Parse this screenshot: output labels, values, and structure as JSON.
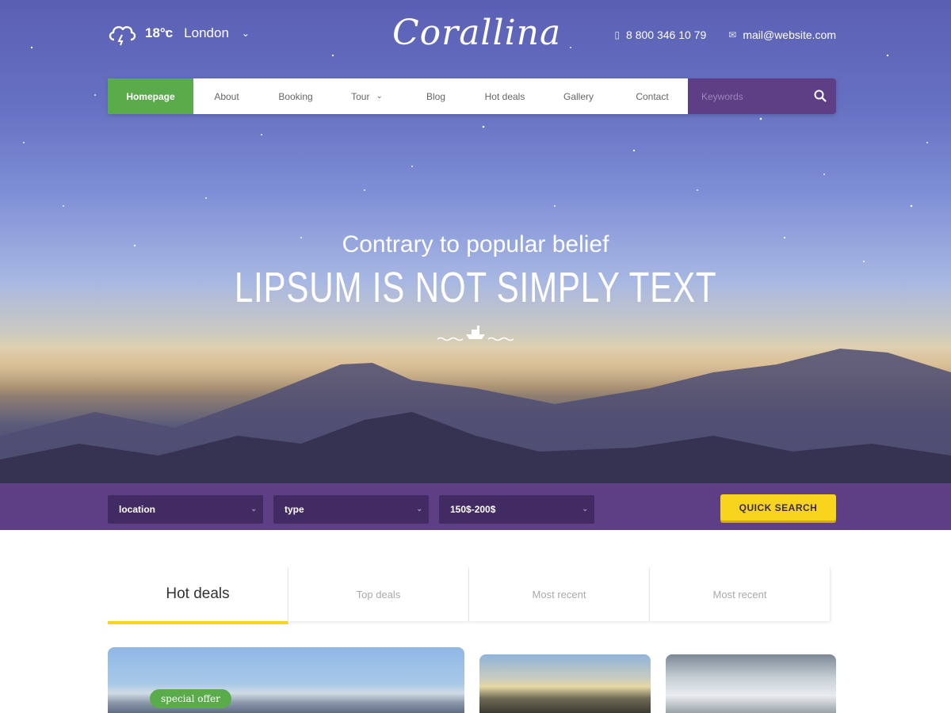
{
  "header": {
    "weather": {
      "temperature": "18°c",
      "city": "London",
      "icon": "cloud-lightning-icon"
    },
    "logo": "Corallina",
    "phone": "8 800 346 10 79",
    "email": "mail@website.com"
  },
  "nav": {
    "items": [
      {
        "label": "Homepage",
        "active": true
      },
      {
        "label": "About"
      },
      {
        "label": "Booking"
      },
      {
        "label": "Tour",
        "has_dropdown": true
      },
      {
        "label": "Blog"
      },
      {
        "label": "Hot deals"
      },
      {
        "label": "Gallery"
      },
      {
        "label": "Contact"
      }
    ],
    "search_placeholder": "Keywords"
  },
  "hero": {
    "subtitle": "Contrary to popular belief",
    "title": "LIPSUM IS NOT SIMPLY TEXT"
  },
  "quick_search": {
    "location": "location",
    "type": "type",
    "price": "150$-200$",
    "button": "QUICK SEARCH"
  },
  "tabs": [
    {
      "label": "Hot deals",
      "active": true
    },
    {
      "label": "Top deals"
    },
    {
      "label": "Most recent"
    },
    {
      "label": "Most recent"
    }
  ],
  "cards": {
    "badge": "special offer"
  },
  "colors": {
    "accent_green": "#5aac4b",
    "accent_purple": "#5e3f86",
    "accent_yellow": "#f8d51c"
  }
}
